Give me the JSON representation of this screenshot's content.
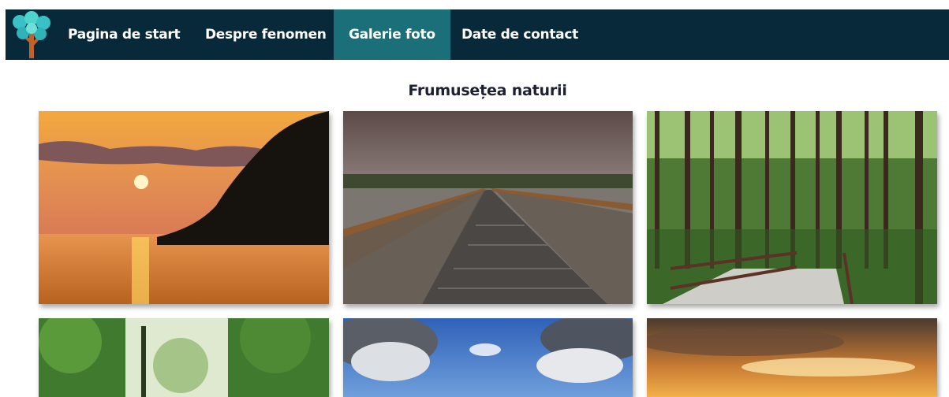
{
  "nav": {
    "logo": "tree-logo",
    "items": [
      {
        "label": "Pagina de start",
        "active": false
      },
      {
        "label": "Despre fenomen",
        "active": false
      },
      {
        "label": "Galerie foto",
        "active": true
      },
      {
        "label": "Date de contact",
        "active": false
      }
    ]
  },
  "gallery": {
    "title": "Frumusețea naturii",
    "photos": [
      {
        "subject": "sunset over sea"
      },
      {
        "subject": "wooden boardwalk over river"
      },
      {
        "subject": "forest bridge"
      },
      {
        "subject": "sunlit forest"
      },
      {
        "subject": "blue sky with clouds"
      },
      {
        "subject": "orange sunset sky"
      }
    ]
  },
  "colors": {
    "nav_bg": "#07293a",
    "nav_active": "#1a6f78",
    "nav_text": "#ffffff",
    "title_text": "#1c2030"
  }
}
